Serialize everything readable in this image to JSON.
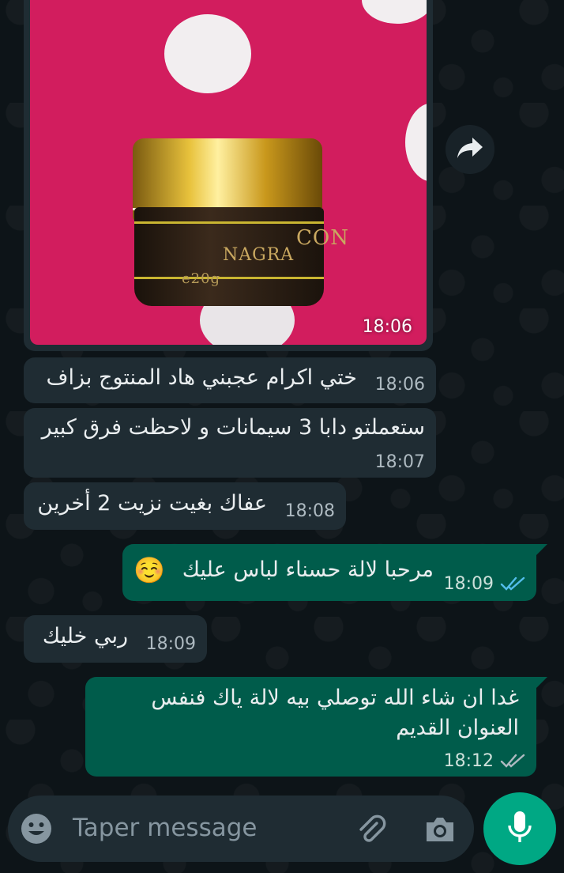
{
  "chat": {
    "image_message": {
      "time": "18:06"
    },
    "messages": [
      {
        "id": "m1",
        "text": "ختي اكرام عجبني هاد المنتوج بزاف",
        "time": "18:06"
      },
      {
        "id": "m2",
        "text": "ستعملتو دابا 3 سيمانات و لاحظت فرق كبير",
        "time": "18:07"
      },
      {
        "id": "m3",
        "text": "عفاك بغيت نزيت 2 أخرين",
        "time": "18:08"
      },
      {
        "id": "m4",
        "text": "مرحبا لالة حسناء لباس عليك",
        "emoji": "☺️",
        "time": "18:09"
      },
      {
        "id": "m5",
        "text": "ربي خليك",
        "time": "18:09"
      },
      {
        "id": "m6",
        "line1": "غدا ان شاء الله توصلي بيه لالة ياك فنفس",
        "line2": "العنوان القديم",
        "time": "18:12"
      }
    ],
    "jar_label": {
      "brand": "NAGRA",
      "partial": "CON",
      "weight": "e20g"
    }
  },
  "composer": {
    "placeholder": "Taper message",
    "icons": {
      "emoji": "emoji-icon",
      "attach": "paperclip-icon",
      "camera": "camera-icon",
      "mic": "mic-icon"
    }
  },
  "colors": {
    "outgoing": "#005c4b",
    "incoming": "#1f2c33",
    "accent": "#00a884",
    "read_ticks": "#53bdeb"
  }
}
